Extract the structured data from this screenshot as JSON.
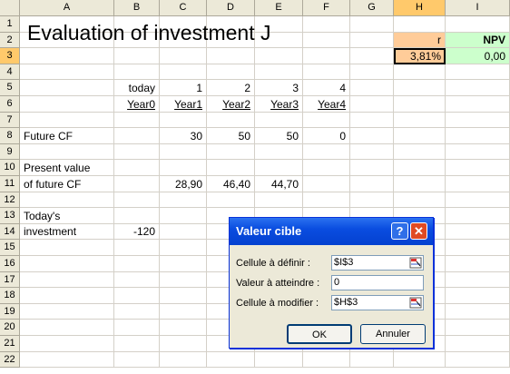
{
  "columns": [
    "A",
    "B",
    "C",
    "D",
    "E",
    "F",
    "G",
    "H",
    "I"
  ],
  "rows": [
    "1",
    "2",
    "3",
    "4",
    "5",
    "6",
    "7",
    "8",
    "9",
    "10",
    "11",
    "12",
    "13",
    "14",
    "15",
    "16",
    "17",
    "18",
    "19",
    "20",
    "21",
    "22"
  ],
  "title": "Evaluation of investment J",
  "cells": {
    "H2": "r",
    "I2": "NPV",
    "H3": "3,81%",
    "I3": "0,00",
    "B5": "today",
    "C5": "1",
    "D5": "2",
    "E5": "3",
    "F5": "4",
    "B6": "Year0",
    "C6": "Year1",
    "D6": "Year2",
    "E6": "Year3",
    "F6": "Year4",
    "A8": "Future CF",
    "C8": "30",
    "D8": "50",
    "E8": "50",
    "F8": "0",
    "A10": "Present value",
    "A11": "of future CF",
    "C11": "28,90",
    "D11": "46,40",
    "E11": "44,70",
    "A13": "Today's",
    "A14": "investment",
    "B14": "-120"
  },
  "colors": {
    "r_header": "#ffcc99",
    "npv_header": "#ccffcc",
    "selected_header": "#ffc96b",
    "dialog_title": "#0a4de0"
  },
  "dialog": {
    "title": "Valeur cible",
    "help_icon": "?",
    "close_icon": "✕",
    "set_cell_label": "Cellule à définir :",
    "set_cell_value": "$I$3",
    "to_value_label": "Valeur à atteindre :",
    "to_value_value": "0",
    "changing_cell_label": "Cellule à modifier :",
    "changing_cell_value": "$H$3",
    "ok_label": "OK",
    "cancel_label": "Annuler"
  }
}
